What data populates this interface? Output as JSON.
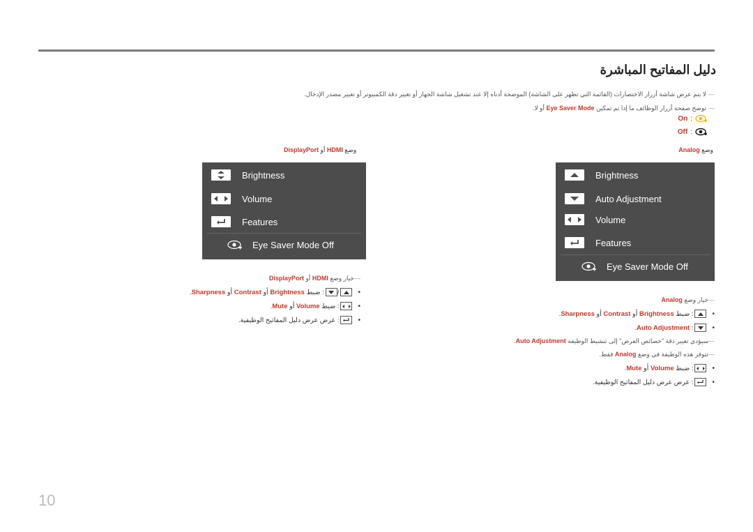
{
  "title": "دليل المفاتيح المباشرة",
  "notes": {
    "note1": "لا يتم عرض شاشة أزرار الاختصارات (القائمة التي تظهر على الشاشة) الموضحة أدناه إلا عند تشغيل شاشة الجهاز أو تغيير دقة الكمبيوتر أو تغيير مصدر الإدخال.",
    "note2_pre": "توضح صفحة أزرار الوظائف ما إذا تم تمكين",
    "note2_hl": "Eye Saver Mode",
    "note2_post": "أو لا.",
    "on_label": "On",
    "off_label": "Off",
    "separator": ":"
  },
  "left": {
    "mode_prefix": "وضع",
    "mode_hdmi": "HDMI",
    "mode_or": "أو",
    "mode_dp": "DisplayPort",
    "osd": {
      "items": [
        "Brightness",
        "Volume",
        "Features"
      ],
      "eye": "Eye Saver Mode Off"
    },
    "option_prefix": "خيار وضع",
    "bullets": {
      "b1_pre": ": ضبط",
      "b1_brightness": "Brightness",
      "b1_or1": "أو",
      "b1_contrast": "Contrast",
      "b1_or2": "أو",
      "b1_sharpness": "Sharpness",
      "b2_pre": ": ضبط",
      "b2_volume": "Volume",
      "b2_or": "أو",
      "b2_mute": "Mute",
      "b3": ": عرض عرض دليل المفاتيح الوظيفية."
    }
  },
  "right": {
    "mode_prefix": "وضع",
    "mode_analog": "Analog",
    "osd": {
      "items": [
        "Brightness",
        "Auto Adjustment",
        "Volume",
        "Features"
      ],
      "eye": "Eye Saver Mode Off"
    },
    "option_prefix": "خيار وضع",
    "bullets": {
      "b1_pre": ": ضبط",
      "b1_brightness": "Brightness",
      "b1_or1": "أو",
      "b1_contrast": "Contrast",
      "b1_or2": "أو",
      "b1_sharpness": "Sharpness",
      "b2_auto": "Auto Adjustment",
      "sub1_pre": "سيؤدي تغيير دقة \"خصائص العرض\" إلى تنشيط الوظيفة",
      "sub1_hl": "Auto Adjustment",
      "sub2_pre": "تتوفر هذه الوظيفة في وضع",
      "sub2_hl": "Analog",
      "sub2_post": "فقط.",
      "b3_pre": ": ضبط",
      "b3_volume": "Volume",
      "b3_or": "أو",
      "b3_mute": "Mute",
      "b4": ": عرض عرض دليل المفاتيح الوظيفية."
    }
  },
  "page_number": "10",
  "colors": {
    "accent": "#c0392b",
    "osd_bg": "#4b4c4b",
    "eye_on": "#f5b800"
  }
}
